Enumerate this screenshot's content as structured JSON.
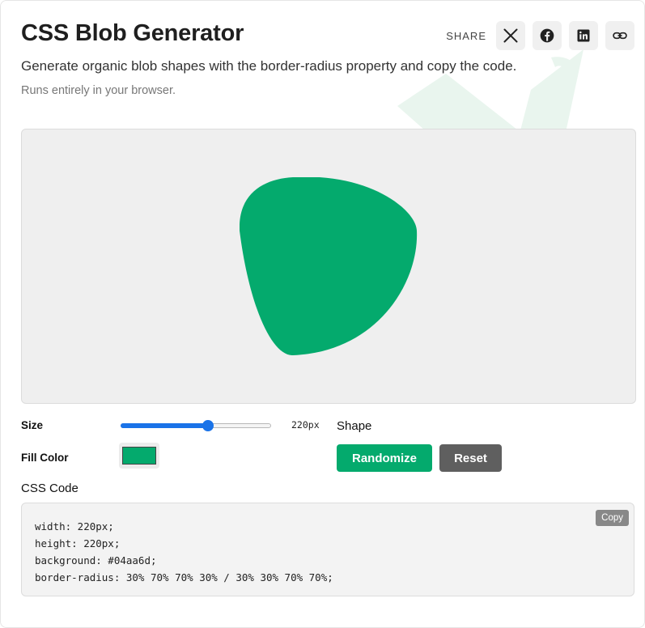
{
  "header": {
    "title": "CSS Blob Generator",
    "subtitle": "Generate organic blob shapes with the border-radius property and copy the code.",
    "note": "Runs entirely in your browser."
  },
  "share": {
    "label": "SHARE",
    "buttons": [
      "x-icon",
      "facebook-icon",
      "linkedin-icon",
      "link-icon"
    ]
  },
  "preview": {
    "background": "#efefef",
    "blob_color": "#04aa6d"
  },
  "controls": {
    "size_label": "Size",
    "size_value": "220px",
    "size_slider_fraction": 0.58,
    "fill_label": "Fill Color",
    "fill_color": "#04aa6d",
    "shape_label": "Shape",
    "randomize_label": "Randomize",
    "reset_label": "Reset"
  },
  "code": {
    "label": "CSS Code",
    "copy_label": "Copy",
    "lines": [
      "width: 220px;",
      "height: 220px;",
      "background: #04aa6d;",
      "border-radius: 30% 70% 70% 30% / 30% 30% 70% 70%;"
    ]
  },
  "colors": {
    "accent": "#04aa6d",
    "reset": "#5f5f5f",
    "slider": "#1a73e8"
  }
}
